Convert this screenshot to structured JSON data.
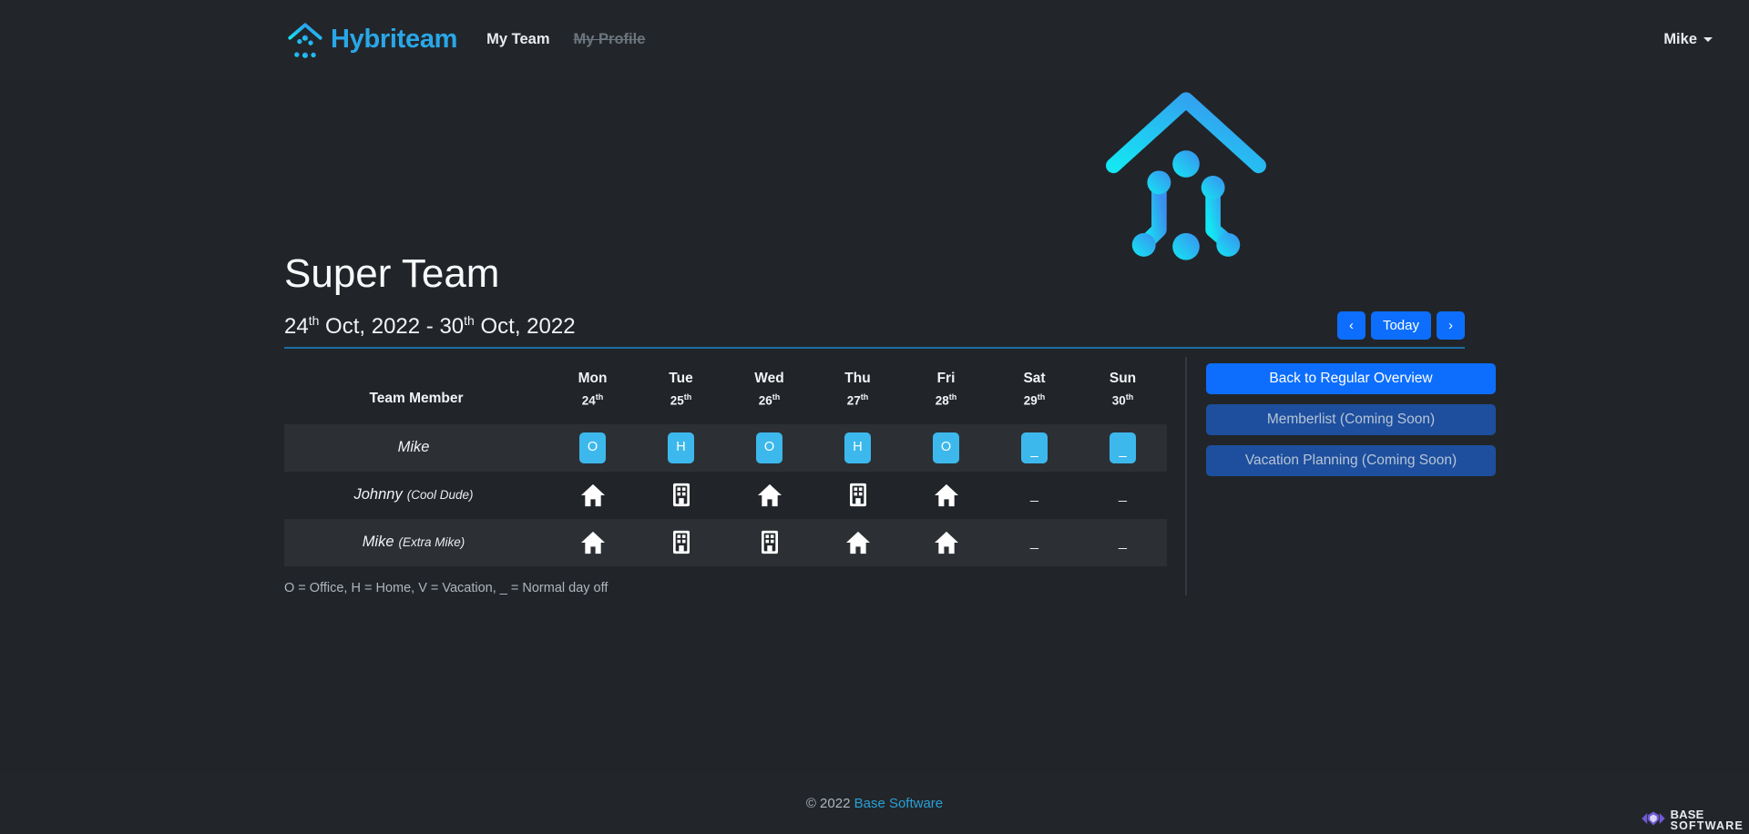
{
  "navbar": {
    "brand": "Hybriteam",
    "brand_icon": "house-circuit-logo-icon",
    "links": [
      {
        "label": "My Team",
        "state": "active"
      },
      {
        "label": "My Profile",
        "state": "disabled"
      }
    ],
    "user_menu": {
      "label": "Mike",
      "icon": "caret-down-icon"
    }
  },
  "hero": {
    "logo_icon": "house-circuit-logo-large-icon",
    "title": "Super Team",
    "date_range": {
      "start_day": "24",
      "start_suffix": "th",
      "start_rest": " Oct, 2022",
      "separator": " - ",
      "end_day": "30",
      "end_suffix": "th",
      "end_rest": " Oct, 2022",
      "full": "24th Oct, 2022 - 30th Oct, 2022"
    },
    "date_nav": {
      "prev_label": "‹",
      "prev_icon": "chevron-left-icon",
      "today_label": "Today",
      "next_label": "›",
      "next_icon": "chevron-right-icon"
    }
  },
  "table": {
    "member_header": "Team Member",
    "days": [
      {
        "name": "Mon",
        "num": "24",
        "suffix": "th"
      },
      {
        "name": "Tue",
        "num": "25",
        "suffix": "th"
      },
      {
        "name": "Wed",
        "num": "26",
        "suffix": "th"
      },
      {
        "name": "Thu",
        "num": "27",
        "suffix": "th"
      },
      {
        "name": "Fri",
        "num": "28",
        "suffix": "th"
      },
      {
        "name": "Sat",
        "num": "29",
        "suffix": "th"
      },
      {
        "name": "Sun",
        "num": "30",
        "suffix": "th"
      }
    ],
    "rows": [
      {
        "name": "Mike",
        "nickname": "",
        "render": "badge",
        "cells": [
          {
            "code": "O",
            "kind": "badge"
          },
          {
            "code": "H",
            "kind": "badge"
          },
          {
            "code": "O",
            "kind": "badge"
          },
          {
            "code": "H",
            "kind": "badge"
          },
          {
            "code": "O",
            "kind": "badge"
          },
          {
            "code": "_",
            "kind": "badge"
          },
          {
            "code": "_",
            "kind": "badge"
          }
        ]
      },
      {
        "name": "Johnny",
        "nickname": "(Cool Dude)",
        "render": "icon",
        "cells": [
          {
            "code": "H",
            "kind": "icon",
            "icon": "home-icon"
          },
          {
            "code": "O",
            "kind": "icon",
            "icon": "office-building-icon"
          },
          {
            "code": "H",
            "kind": "icon",
            "icon": "home-icon"
          },
          {
            "code": "O",
            "kind": "icon",
            "icon": "office-building-icon"
          },
          {
            "code": "H",
            "kind": "icon",
            "icon": "home-icon"
          },
          {
            "code": "_",
            "kind": "dash"
          },
          {
            "code": "_",
            "kind": "dash"
          }
        ]
      },
      {
        "name": "Mike",
        "nickname": "(Extra Mike)",
        "render": "icon",
        "cells": [
          {
            "code": "H",
            "kind": "icon",
            "icon": "home-icon"
          },
          {
            "code": "O",
            "kind": "icon",
            "icon": "office-building-icon"
          },
          {
            "code": "O",
            "kind": "icon",
            "icon": "office-building-icon"
          },
          {
            "code": "H",
            "kind": "icon",
            "icon": "home-icon"
          },
          {
            "code": "H",
            "kind": "icon",
            "icon": "home-icon"
          },
          {
            "code": "_",
            "kind": "dash"
          },
          {
            "code": "_",
            "kind": "dash"
          }
        ]
      }
    ],
    "legend": "O = Office, H = Home, V = Vacation, _ = Normal day off"
  },
  "sidebar": {
    "buttons": [
      {
        "label": "Back to Regular Overview",
        "state": "primary"
      },
      {
        "label": "Memberlist (Coming Soon)",
        "state": "muted"
      },
      {
        "label": "Vacation Planning (Coming Soon)",
        "state": "muted"
      }
    ]
  },
  "footer": {
    "copyright": "© 2022 ",
    "link": "Base Software",
    "brand_logo": {
      "line1": "BASE",
      "line2": "SOFTWARE",
      "icon": "base-software-shield-icon"
    }
  },
  "colors": {
    "page_bg": "#212529",
    "bar_bg": "#22262a",
    "accent_blue": "#0d6efd",
    "badge_blue": "#3db8ec",
    "brand_cyan": "#29a7e8",
    "link_blue": "#2a9fd6",
    "muted_btn": "#1e4f9e",
    "row_alt": "#2c3034",
    "base_purple": "#6f5ad6"
  }
}
